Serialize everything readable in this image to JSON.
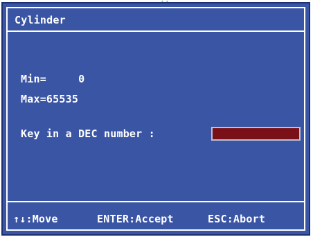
{
  "dialog": {
    "title": "Cylinder",
    "min_text": "Min=     0",
    "max_text": "Max=65535",
    "prompt_text": "Key in a DEC number :",
    "input_value": ""
  },
  "footer": {
    "move_hint": "↑↓:Move",
    "enter_hint": "ENTER:Accept",
    "esc_hint": "ESC:Abort"
  },
  "colors": {
    "dialog_bg": "#3a55a4",
    "input_bg": "#7a1018",
    "text": "#ffffff",
    "marker": "#7ed957"
  }
}
